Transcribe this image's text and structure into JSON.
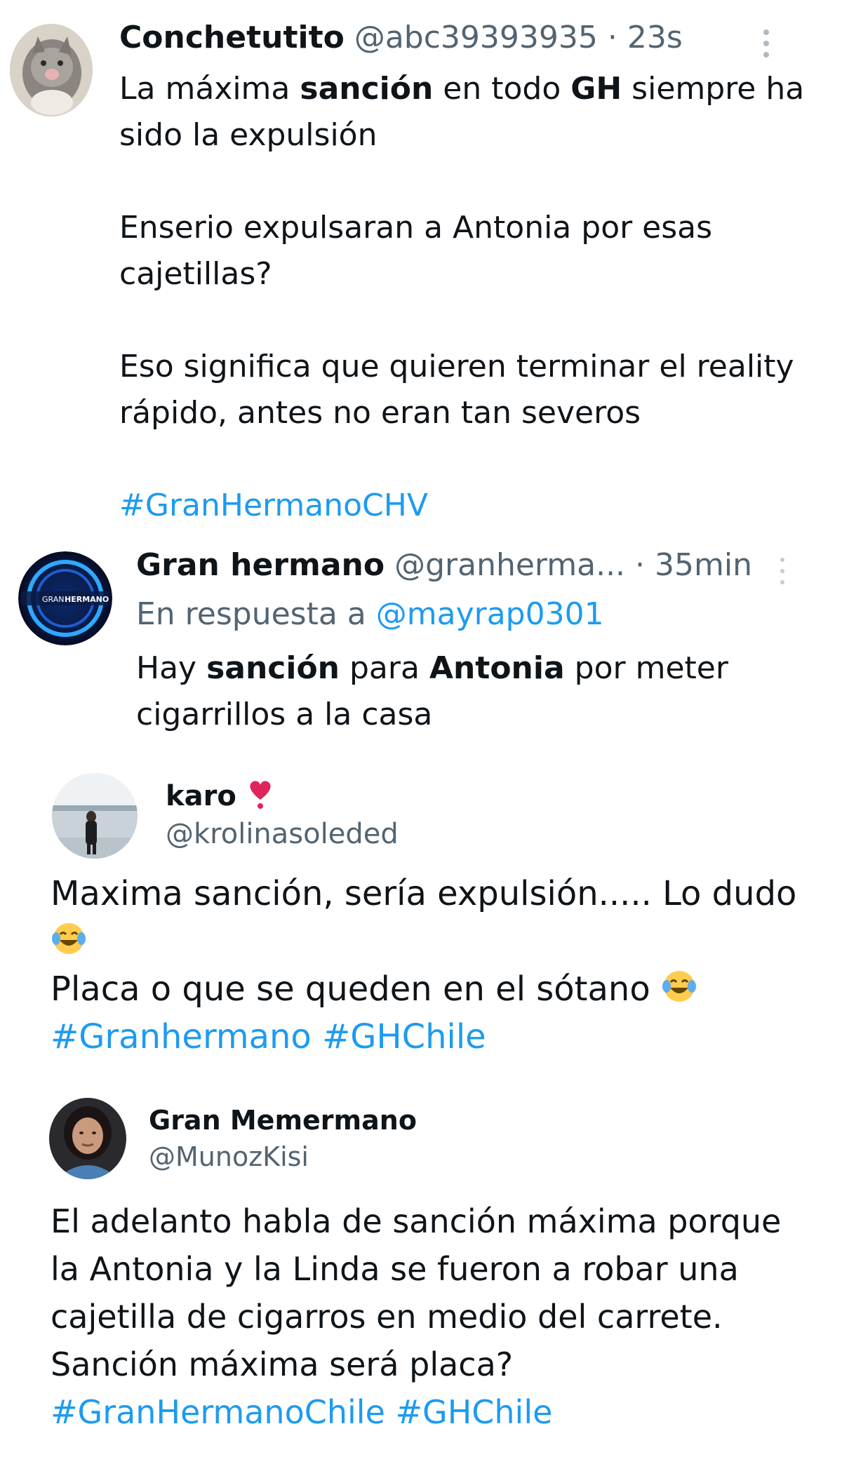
{
  "colors": {
    "text": "#0f1419",
    "muted": "#536471",
    "link": "#1d9bf0"
  },
  "tweet1": {
    "display_name": "Conchetutito",
    "handle": "@abc39393935",
    "separator": "·",
    "time": "23s",
    "avatar_icon": "cat-photo-avatar",
    "more_icon": "more-vertical-icon",
    "line1_a": "La máxima ",
    "line1_b": "sanción",
    "line1_c": " en todo ",
    "line1_d": "GH",
    "line1_e": " siempre ha sido la expulsión",
    "para2": "Enserio expulsaran a Antonia por esas cajetillas?",
    "para3": "Eso significa que quieren terminar el reality rápido, antes no eran tan severos",
    "hashtag": "#GranHermanoCHV"
  },
  "tweet2": {
    "display_name": "Gran hermano",
    "handle": "@granherma...",
    "separator": "·",
    "time": "35min",
    "avatar_icon": "gran-hermano-logo-avatar",
    "logo_text_a": "GRAN",
    "logo_text_b": "HERMANO",
    "more_icon": "more-vertical-icon",
    "reply_prefix": "En respuesta a ",
    "reply_handle": "@mayrap0301",
    "text_a": "Hay ",
    "text_b": "sanción",
    "text_c": " para ",
    "text_d": "Antonia",
    "text_e": " por meter cigarrillos a la casa"
  },
  "tweet3": {
    "display_name": "karo",
    "name_emoji": "heart-exclamation-icon",
    "handle": "@krolinasoleded",
    "avatar_icon": "person-photo-avatar",
    "line1": "Maxima sanción, sería expulsión..... Lo dudo",
    "emoji1": "laughing-crying-emoji",
    "line2": "Placa o que se queden en el sótano",
    "emoji2": "laughing-crying-emoji",
    "hashtag1": "#Granhermano",
    "hashtag2": "#GHChile"
  },
  "tweet4": {
    "display_name": "Gran Memermano",
    "handle": "@MunozKisi",
    "avatar_icon": "woman-photo-avatar",
    "text": "El adelanto habla de sanción máxima porque la Antonia y la Linda se fueron a robar una cajetilla de cigarros en medio del carrete. Sanción máxima será placa?",
    "hashtag1": "#GranHermanoChile",
    "hashtag2": "#GHChile"
  }
}
